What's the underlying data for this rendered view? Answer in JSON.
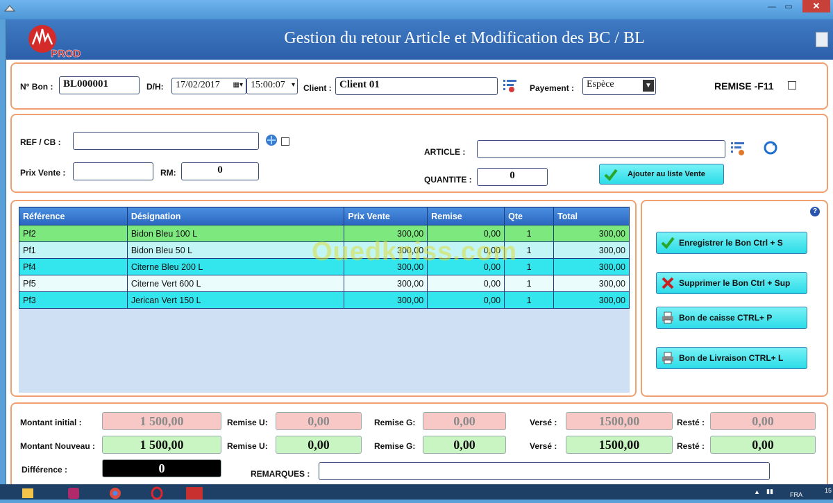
{
  "window": {
    "title": "Gestion du retour Article et  Modification des BC / BL",
    "brand": "PROD",
    "close_label": "✕",
    "min_label": "—",
    "max_label": "▭"
  },
  "header_panel": {
    "bon_label": "N° Bon :",
    "bon_value": "BL000001",
    "dh_label": "D/H:",
    "date_value": "17/02/2017",
    "time_value": "15:00:07",
    "client_label": "Client :",
    "client_value": "Client 01",
    "payement_label": "Payement :",
    "payement_value": "Espèce",
    "remise_label": "REMISE -F11"
  },
  "article_panel": {
    "ref_label": "REF  / CB :",
    "ref_value": "",
    "prix_label": "Prix Vente :",
    "prix_value": "",
    "rm_label": "RM:",
    "rm_value": "0",
    "article_label": "ARTICLE :",
    "article_value": "",
    "quantite_label": "QUANTITE :",
    "quantite_value": "0",
    "add_button": "Ajouter au liste  Vente"
  },
  "table": {
    "columns": [
      "Référence",
      "Désignation",
      "Prix Vente",
      "Remise",
      "Qte",
      "Total"
    ],
    "rows": [
      {
        "ref": "Pf2",
        "designation": "Bidon Bleu 100 L",
        "prix": "300,00",
        "remise": "0,00",
        "qte": "1",
        "total": "300,00",
        "color": "#7de87d"
      },
      {
        "ref": "Pf1",
        "designation": "Bidon Bleu 50 L",
        "prix": "300,00",
        "remise": "0,00",
        "qte": "1",
        "total": "300,00",
        "color": "#c2f6f6"
      },
      {
        "ref": "Pf4",
        "designation": "Citerne Bleu 200 L",
        "prix": "300,00",
        "remise": "0,00",
        "qte": "1",
        "total": "300,00",
        "color": "#33e6ee"
      },
      {
        "ref": "Pf5",
        "designation": "Citerne Vert 600 L",
        "prix": "300,00",
        "remise": "0,00",
        "qte": "1",
        "total": "300,00",
        "color": "#eafcfc"
      },
      {
        "ref": "Pf3",
        "designation": "Jerican Vert 150 L",
        "prix": "300,00",
        "remise": "0,00",
        "qte": "1",
        "total": "300,00",
        "color": "#33e6ee"
      }
    ]
  },
  "watermark": "Ouedkniss.com",
  "actions": {
    "help": "?",
    "save": "Enregistrer le Bon    Ctrl + S",
    "delete": "Supprimer le Bon   Ctrl + Sup",
    "caisse": "Bon de caisse        CTRL+ P",
    "livraison": "Bon de Livraison    CTRL+ L"
  },
  "totals": {
    "montant_initial_label": "Montant initial :",
    "montant_initial": "1 500,00",
    "montant_nouveau_label": "Montant Nouveau :",
    "montant_nouveau": "1 500,00",
    "remise_u_label": "Remise U:",
    "remise_u_initial": "0,00",
    "remise_u_nouveau": "0,00",
    "remise_g_label": "Remise G:",
    "remise_g_initial": "0,00",
    "remise_g_nouveau": "0,00",
    "verse_label": "Versé :",
    "verse_initial": "1500,00",
    "verse_nouveau": "1500,00",
    "reste_label": "Resté :",
    "reste_initial": "0,00",
    "reste_nouveau": "0,00",
    "difference_label": "Différence  :",
    "difference": "0",
    "remarques_label": "REMARQUES :",
    "remarques": ""
  },
  "taskbar": {
    "lang": "FRA",
    "clock": "15"
  }
}
